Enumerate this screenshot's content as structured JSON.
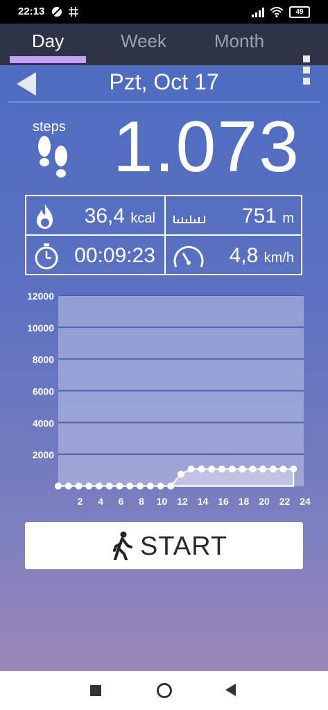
{
  "status_bar": {
    "time": "22:13",
    "battery": "49"
  },
  "tabs": [
    {
      "label": "Day",
      "active": true
    },
    {
      "label": "Week",
      "active": false
    },
    {
      "label": "Month",
      "active": false
    }
  ],
  "date": "Pzt, Oct 17",
  "steps": {
    "label": "steps",
    "value": "1.073"
  },
  "stats": {
    "calories": {
      "value": "36,4",
      "unit": "kcal",
      "icon": "flame-icon"
    },
    "distance": {
      "value": "751",
      "unit": "m",
      "icon": "ruler-icon"
    },
    "duration": {
      "value": "00:09:23",
      "icon": "stopwatch-icon"
    },
    "speed": {
      "value": "4,8",
      "unit": "km/h",
      "icon": "speedometer-icon"
    }
  },
  "chart_data": {
    "type": "area",
    "xlabel": "",
    "ylabel": "",
    "ylim": [
      0,
      12000
    ],
    "xlim": [
      0,
      24
    ],
    "y_ticks": [
      2000,
      4000,
      6000,
      8000,
      10000,
      12000
    ],
    "x_ticks": [
      2,
      4,
      6,
      8,
      10,
      12,
      14,
      16,
      18,
      20,
      22,
      24
    ],
    "grid": true,
    "series": [
      {
        "x": [
          0,
          1,
          2,
          3,
          4,
          5,
          6,
          7,
          8,
          9,
          10,
          11,
          12,
          13,
          14,
          15,
          16,
          17,
          18,
          19,
          20,
          21,
          22,
          23
        ],
        "values": [
          0,
          0,
          0,
          0,
          0,
          0,
          0,
          0,
          0,
          0,
          0,
          0,
          750,
          1073,
          1073,
          1073,
          1073,
          1073,
          1073,
          1073,
          1073,
          1073,
          1073,
          1073
        ]
      }
    ]
  },
  "start_button": {
    "label": "START",
    "icon": "walking-person-icon"
  },
  "colors": {
    "tab_indicator": "#c6a3f2",
    "tab_bar": "#2e3447",
    "gradient_top": "#4a6cc0",
    "gradient_bottom": "#9b86b8"
  }
}
